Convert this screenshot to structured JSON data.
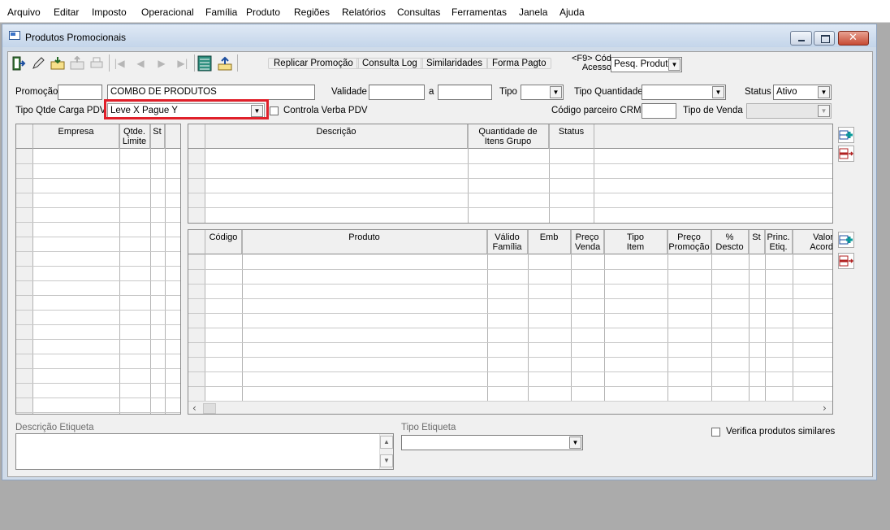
{
  "menu": [
    "Arquivo",
    "Editar",
    "Imposto",
    "Operacional",
    "Família",
    "Produto",
    "Regiões",
    "Relatórios",
    "Consultas",
    "Ferramentas",
    "Janela",
    "Ajuda"
  ],
  "window": {
    "title": "Produtos Promocionais"
  },
  "toolbar": {
    "icons": [
      "exit-icon",
      "edit-pencil-icon",
      "add-folder-icon",
      "remove-folder-icon",
      "print-icon",
      "first-record-icon",
      "previous-record-icon",
      "next-record-icon",
      "last-record-icon",
      "grid-view-icon",
      "save-icon"
    ],
    "buttons": [
      "Replicar Promoção",
      "Consulta Log",
      "Similaridades",
      "Forma Pagto"
    ],
    "access_label_line1": "<F9> Cód",
    "access_label_line2": "Acesso",
    "access_value": "Pesq. Produto"
  },
  "form": {
    "promocao_label": "Promoção",
    "promocao_code": "",
    "promocao_desc": "COMBO DE PRODUTOS",
    "validade_label": "Validade",
    "validade_de": "",
    "a_label": "a",
    "validade_ate": "",
    "tipo_label": "Tipo",
    "tipo_value": "",
    "tipo_quantidade_label": "Tipo Quantidade",
    "tipo_quantidade_value": "",
    "status_label": "Status",
    "status_value": "Ativo",
    "tipo_qtde_label": "Tipo Qtde Carga PDV",
    "tipo_qtde_value": "Leve X Pague Y",
    "controla_verba_label": "Controla Verba PDV",
    "controla_verba_checked": false,
    "codigo_crm_label": "Código parceiro CRM",
    "codigo_crm_value": "",
    "tipo_venda_label": "Tipo de Venda",
    "tipo_venda_value": ""
  },
  "grid_empresa": {
    "columns": [
      "Empresa",
      "Qtde. Limite",
      "St"
    ]
  },
  "grid_grupo": {
    "columns": [
      "Descrição",
      "Quantidade de Itens Grupo",
      "Status"
    ]
  },
  "grid_produto": {
    "columns": [
      "Código",
      "Produto",
      "Válido Família",
      "Emb",
      "Preço Venda",
      "Tipo Item",
      "Preço Promoção",
      "% Descto",
      "St",
      "Princ. Etiq.",
      "Valor Acord"
    ]
  },
  "side_buttons": [
    "add-row-icon",
    "remove-row-icon"
  ],
  "bottom": {
    "descricao_etiqueta_label": "Descrição Etiqueta",
    "descricao_etiqueta_value": "",
    "tipo_etiqueta_label": "Tipo Etiqueta",
    "tipo_etiqueta_value": "",
    "verifica_label": "Verifica produtos similares",
    "verifica_checked": false
  }
}
